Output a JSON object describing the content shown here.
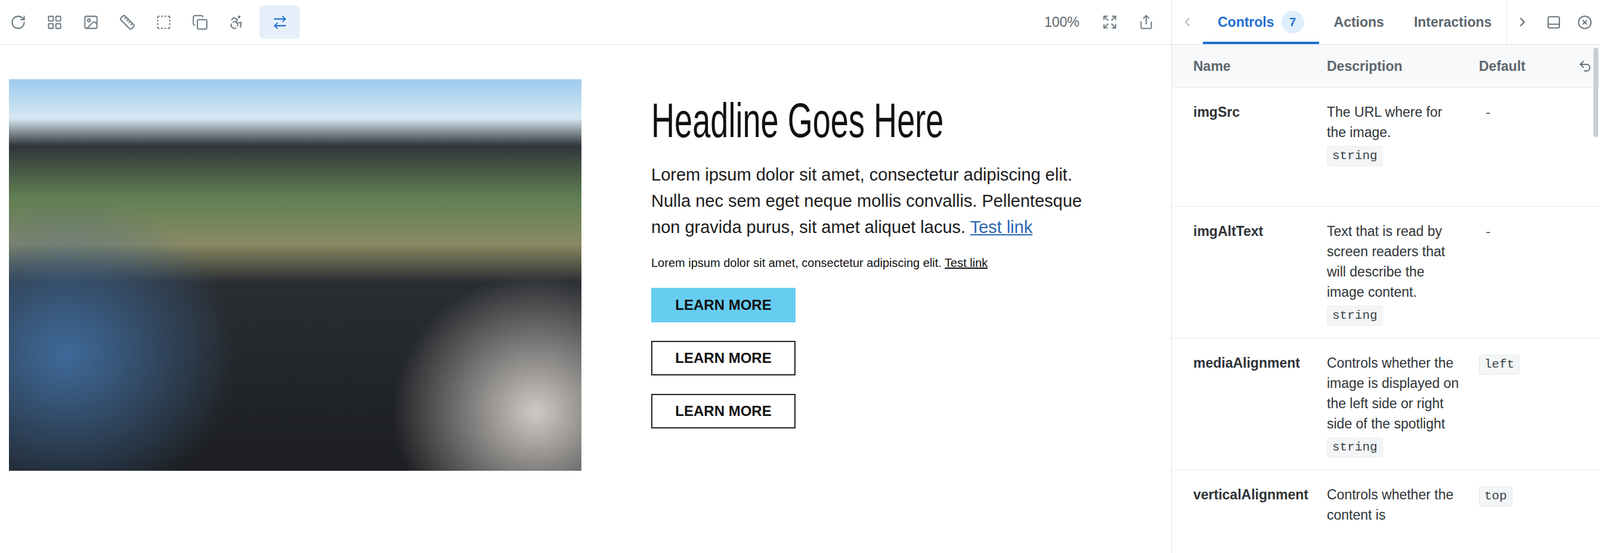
{
  "toolbar": {
    "tools": [
      {
        "selected": false
      },
      {
        "selected": false
      },
      {
        "selected": false
      },
      {
        "selected": false
      },
      {
        "selected": false
      },
      {
        "selected": false
      },
      {
        "selected": false
      },
      {
        "selected": true
      }
    ],
    "zoom": "100%"
  },
  "story": {
    "headline": "Headline Goes Here",
    "body": "Lorem ipsum dolor sit amet, consectetur adipiscing elit. Nulla nec sem eget neque mollis convallis. Pellentesque non gravida purus, sit amet aliquet lacus.",
    "body_link": "Test link",
    "small": "Lorem ipsum dolor sit amet, consectetur adipiscing elit.",
    "small_link": "Test link",
    "buttons": [
      {
        "label": "LEARN MORE",
        "kind": "primary"
      },
      {
        "label": "LEARN MORE",
        "kind": "outline"
      },
      {
        "label": "LEARN MORE",
        "kind": "outline"
      }
    ]
  },
  "addons": {
    "tabs": [
      {
        "label": "Controls",
        "badge": "7",
        "selected": true
      },
      {
        "label": "Actions",
        "selected": false
      },
      {
        "label": "Interactions",
        "selected": false
      }
    ],
    "columns": [
      "Name",
      "Description",
      "Default"
    ],
    "rows": [
      {
        "name": "imgSrc",
        "description": "The URL where for the image.",
        "type": "string",
        "default": "-"
      },
      {
        "name": "imgAltText",
        "description": "Text that is read by screen readers that will describe the image content.",
        "type": "string",
        "default": "-"
      },
      {
        "name": "mediaAlignment",
        "description": "Controls whether the image is displayed on the left side or right side of the spotlight",
        "type": "string",
        "default": "left"
      },
      {
        "name": "verticalAlignment",
        "description": "Controls whether the content is",
        "default": "top"
      }
    ]
  }
}
